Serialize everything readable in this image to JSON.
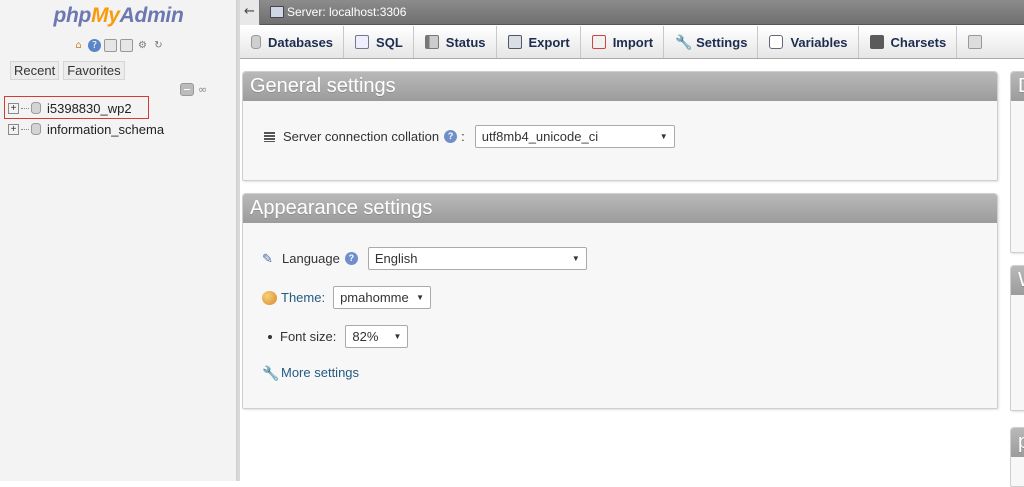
{
  "nav": {
    "logo": {
      "php": "php",
      "my": "My",
      "admin": "Admin"
    },
    "icons": [
      "home-icon",
      "info-icon",
      "docs-icon",
      "sql-docs-icon",
      "gear-icon",
      "reload-icon"
    ],
    "tabs": {
      "recent": "Recent",
      "favorites": "Favorites"
    },
    "databases": [
      {
        "name": "i5398830_wp2",
        "highlighted": true
      },
      {
        "name": "information_schema",
        "highlighted": false
      }
    ]
  },
  "serverbar": {
    "back": "←",
    "label": "Server: localhost:3306"
  },
  "menu": {
    "tabs": [
      {
        "label": "Databases",
        "icon": "database-icon"
      },
      {
        "label": "SQL",
        "icon": "sql-icon"
      },
      {
        "label": "Status",
        "icon": "status-icon"
      },
      {
        "label": "Export",
        "icon": "export-icon"
      },
      {
        "label": "Import",
        "icon": "import-icon"
      },
      {
        "label": "Settings",
        "icon": "wrench-icon"
      },
      {
        "label": "Variables",
        "icon": "variables-icon"
      },
      {
        "label": "Charsets",
        "icon": "charsets-icon"
      }
    ]
  },
  "general": {
    "title": "General settings",
    "collation_label": "Server connection collation",
    "colon": ":",
    "collation_value": "utf8mb4_unicode_ci"
  },
  "appearance": {
    "title": "Appearance settings",
    "language_label": "Language",
    "language_value": "English",
    "theme_label": "Theme:",
    "theme_value": "pmahomme",
    "fontsize_label": "Font size:",
    "fontsize_value": "82%",
    "more_settings": "More settings"
  },
  "right_panels": {
    "p1_title": "D",
    "p2_title": "W",
    "p3_title": "p"
  },
  "colors": {
    "panel_head": "#a8a8a8",
    "highlight": "#d33b33",
    "link": "#235a81"
  }
}
